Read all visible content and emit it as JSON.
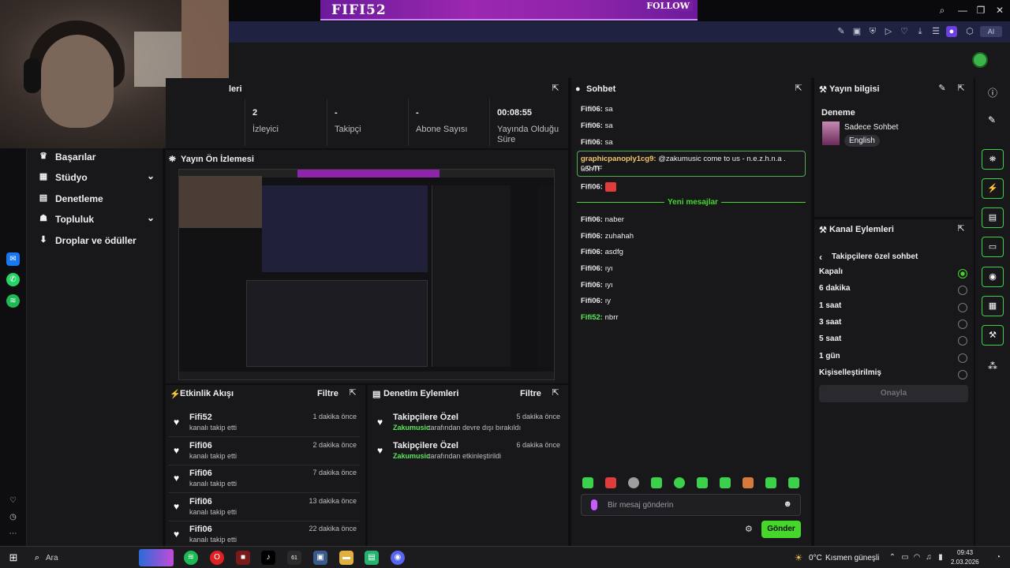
{
  "banner": {
    "brand": "FIFI52",
    "follow": "FOLLOW"
  },
  "browser": {
    "toolbar_ai": "AI"
  },
  "stats": {
    "title_fragment": "leri",
    "viewers_value": "2",
    "viewers_label": "İzleyici",
    "followers_value": "-",
    "followers_label": "Takipçi",
    "subs_value": "-",
    "subs_label": "Abone Sayısı",
    "uptime_value": "00:08:55",
    "uptime_label_1": "Yayında Olduğu",
    "uptime_label_2": "Süre"
  },
  "sidebar": {
    "items": [
      {
        "label": "Başarılar"
      },
      {
        "label": "Stüdyo"
      },
      {
        "label": "Denetleme"
      },
      {
        "label": "Topluluk"
      },
      {
        "label": "Droplar ve ödüller"
      }
    ]
  },
  "preview": {
    "title": "Yayın Ön İzlemesi"
  },
  "activity": {
    "title": "Etkinlik Akışı",
    "filter": "Filtre",
    "items": [
      {
        "name": "Fifi52",
        "desc": "kanalı takip etti",
        "time": "1 dakika önce"
      },
      {
        "name": "Fifi06",
        "desc": "kanalı takip etti",
        "time": "2 dakika önce"
      },
      {
        "name": "Fifi06",
        "desc": "kanalı takip etti",
        "time": "7 dakika önce"
      },
      {
        "name": "Fifi06",
        "desc": "kanalı takip etti",
        "time": "13 dakika önce"
      },
      {
        "name": "Fifi06",
        "desc": "kanalı takip etti",
        "time": "22 dakika önce"
      }
    ]
  },
  "modlog": {
    "title": "Denetim Eylemleri",
    "filter": "Filtre",
    "items": [
      {
        "name": "Takipçilere Özel",
        "user": "Zakumusic",
        "desc": "tarafından devre dışı bırakıldı",
        "time": "5 dakika önce"
      },
      {
        "name": "Takipçilere Özel",
        "user": "Zakumusic",
        "desc": "tarafından etkinleştirildi",
        "time": "6 dakika önce"
      }
    ]
  },
  "chat": {
    "title": "Sohbet",
    "messages_before": [
      {
        "user": "Fifi06:",
        "text": "sa"
      },
      {
        "user": "Fifi06:",
        "text": "sa"
      },
      {
        "user": "Fifi06:",
        "text": "sa"
      }
    ],
    "highlight": {
      "user": "graphicpanoply1cg9:",
      "text": "@zakumusic come to us - n.e.z.h.n.a . c.o.m",
      "text2": "u5hTF"
    },
    "emote_line": {
      "user": "Fifi06:"
    },
    "new_messages": "Yeni mesajlar",
    "messages_after": [
      {
        "user": "Fifi06:",
        "text": "naber"
      },
      {
        "user": "Fifi06:",
        "text": "zuhahah"
      },
      {
        "user": "Fifi06:",
        "text": "asdfg"
      },
      {
        "user": "Fifi06:",
        "text": "ıyı"
      },
      {
        "user": "Fifi06:",
        "text": "ıyı"
      },
      {
        "user": "Fifi06:",
        "text": "ıy"
      },
      {
        "user": "Fifi52:",
        "text": "nbrr"
      }
    ],
    "input_placeholder": "Bir mesaj gönderin",
    "send": "Gönder"
  },
  "stream_info": {
    "title": "Yayın bilgisi",
    "stream_title": "Deneme",
    "category": "Sadece Sohbet",
    "language": "English"
  },
  "channel_actions": {
    "title": "Kanal Eylemleri",
    "back_label": "Takipçilere özel sohbet",
    "options": [
      "Kapalı",
      "6 dakika",
      "1 saat",
      "3 saat",
      "5 saat",
      "1 gün",
      "Kişiselleştirilmiş"
    ],
    "selected_index": 0,
    "approve": "Onayla"
  },
  "taskbar": {
    "search": "Ara",
    "badge": "61",
    "weather_temp": "0°C",
    "weather_text": "Kısmen güneşli",
    "time": "09:43",
    "date": "2.03.2026"
  },
  "colors": {
    "accent_green": "#45d72a",
    "brand_purple": "#9c27b0",
    "user_green": "#59e85a"
  }
}
